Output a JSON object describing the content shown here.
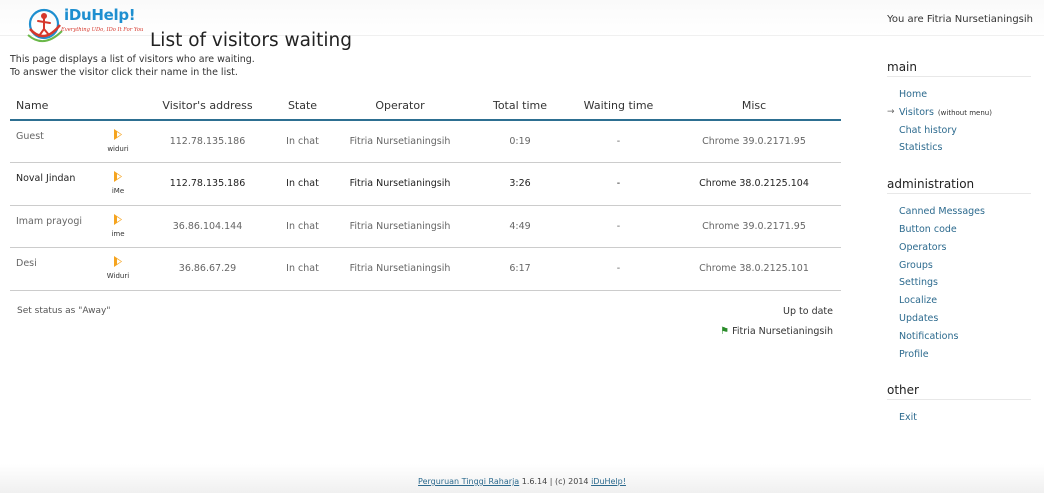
{
  "header": {
    "logo_text": "iDuHelp!",
    "logo_slogan": "Everything UDo, IDo It For You",
    "user_info": "You are Fitria Nursetianingsih"
  },
  "page": {
    "title": "List of visitors waiting",
    "desc_line1": "This page displays a list of visitors who are waiting.",
    "desc_line2": "To answer the visitor click their name in the list."
  },
  "table": {
    "headers": [
      "Name",
      "Visitor's address",
      "State",
      "Operator",
      "Total time",
      "Waiting time",
      "Misc"
    ],
    "rows": [
      {
        "name": "Guest",
        "source": "widuri",
        "address": "112.78.135.186",
        "state": "In chat",
        "operator": "Fitria Nursetianingsih",
        "total": "0:19",
        "waiting": "-",
        "misc": "Chrome 39.0.2171.95"
      },
      {
        "name": "Noval Jindan",
        "source": "iMe",
        "address": "112.78.135.186",
        "state": "In chat",
        "operator": "Fitria Nursetianingsih",
        "total": "3:26",
        "waiting": "-",
        "misc": "Chrome 38.0.2125.104"
      },
      {
        "name": "Imam prayogi",
        "source": "ime",
        "address": "36.86.104.144",
        "state": "In chat",
        "operator": "Fitria Nursetianingsih",
        "total": "4:49",
        "waiting": "-",
        "misc": "Chrome 39.0.2171.95"
      },
      {
        "name": "Desi",
        "source": "Widuri",
        "address": "36.86.67.29",
        "state": "In chat",
        "operator": "Fitria Nursetianingsih",
        "total": "6:17",
        "waiting": "-",
        "misc": "Chrome 38.0.2125.101"
      }
    ]
  },
  "status": {
    "set_away": "Set status as \"Away\"",
    "up_to_date": "Up to date",
    "operator_name": "Fitria Nursetianingsih"
  },
  "sidebar": {
    "main_title": "main",
    "main_items": [
      "Home",
      "Visitors",
      "Chat history",
      "Statistics"
    ],
    "visitors_extra": "(without menu)",
    "admin_title": "administration",
    "admin_items": [
      "Canned Messages",
      "Button code",
      "Operators",
      "Groups",
      "Settings",
      "Localize",
      "Updates",
      "Notifications",
      "Profile"
    ],
    "other_title": "other",
    "other_items": [
      "Exit"
    ]
  },
  "footer": {
    "org_link": "Perguruan Tinggi Raharja",
    "version_text": " 1.6.14 | (c) 2014 ",
    "brand_link": "iDuHelp!"
  },
  "colors": {
    "link": "#2c6a8e",
    "table_header_border": "#2d6f91",
    "logo_blue": "#1e8fd0",
    "logo_red": "#d6372b"
  }
}
